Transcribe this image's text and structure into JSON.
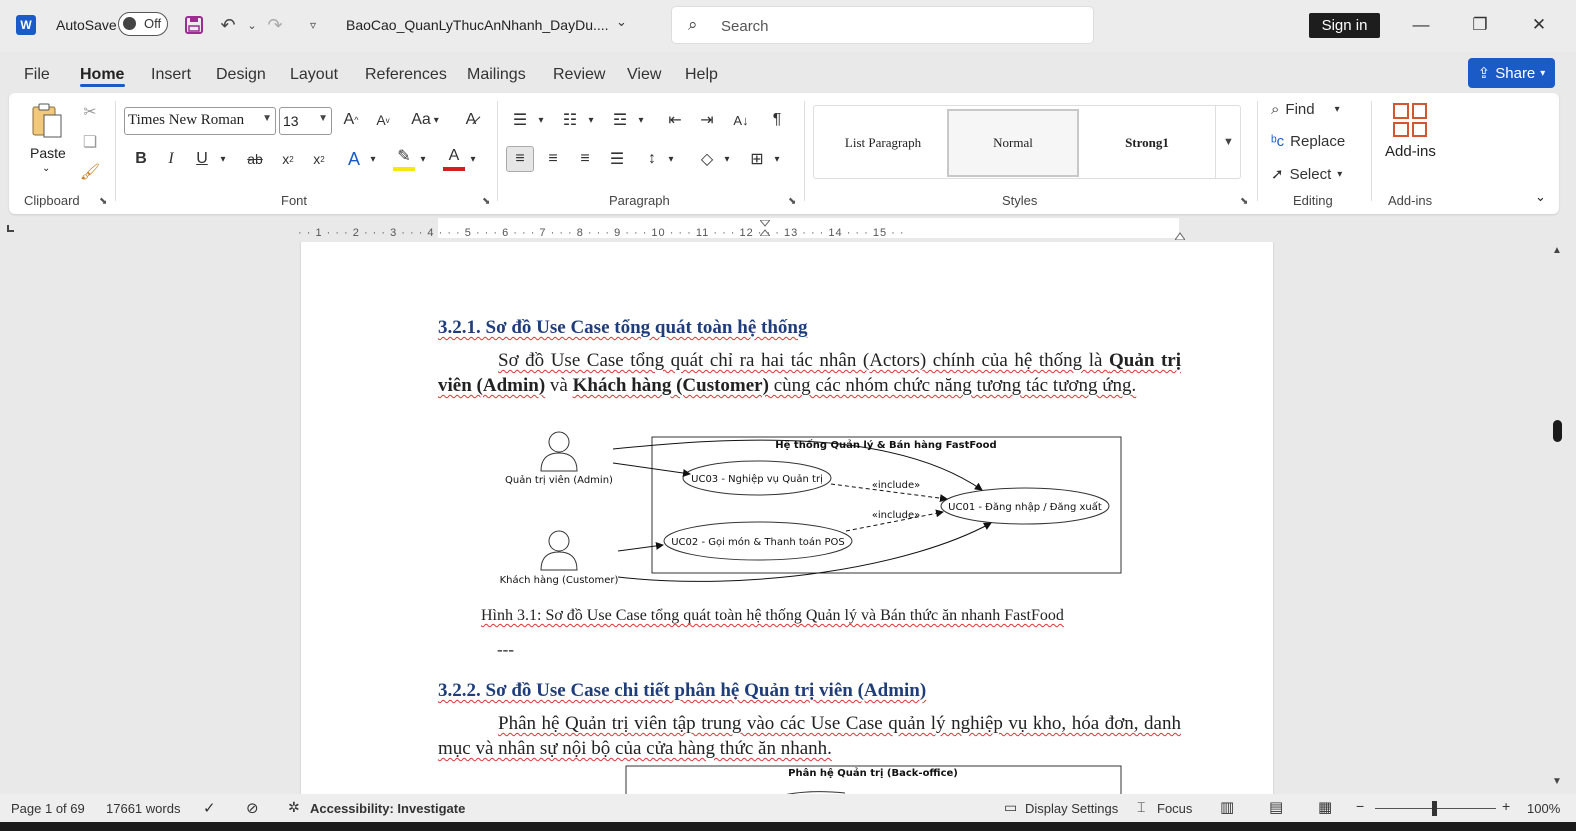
{
  "titlebar": {
    "app_icon": "W",
    "autosave_label": "AutoSave",
    "autosave_state": "Off",
    "doc_title": "BaoCao_QuanLyThucAnNhanh_DayDu....",
    "search_placeholder": "Search",
    "sign_in": "Sign in"
  },
  "tabs": [
    "File",
    "Home",
    "Insert",
    "Design",
    "Layout",
    "References",
    "Mailings",
    "Review",
    "View",
    "Help"
  ],
  "share_label": "Share",
  "ribbon": {
    "clipboard": {
      "paste": "Paste",
      "label": "Clipboard"
    },
    "font": {
      "name": "Times New Roman",
      "size": "13",
      "label": "Font",
      "case_btn": "Aa"
    },
    "paragraph": {
      "label": "Paragraph"
    },
    "styles": {
      "items": [
        "List Paragraph",
        "Normal",
        "Strong1"
      ],
      "label": "Styles"
    },
    "editing": {
      "find": "Find",
      "replace": "Replace",
      "select": "Select",
      "label": "Editing"
    },
    "addins": {
      "button": "Add-ins",
      "label": "Add-ins"
    }
  },
  "ruler_text": "· · 1 · · · 2 · · · 3 · · · 4 · · · 5 · · · 6 · · · 7 · · · 8 · · · 9 · · · 10 · · · 11 · · · 12 · · · 13 · · · 14 · · · 15 · ·",
  "document": {
    "heading1": "3.2.1. Sơ đồ Use Case tổng quát toàn hệ thống",
    "para1": {
      "a": "Sơ đồ Use Case tổng quát chỉ ra hai tác nhân (Actors) chính của hệ thống là ",
      "b": "Quản trị viên (Admin)",
      "c": " và ",
      "d": "Khách hàng (Customer)",
      "e": " cùng các nhóm chức năng tương tác tương ứng."
    },
    "diagram1": {
      "system_title": "Hệ thống Quản lý & Bán hàng FastFood",
      "actor_admin": "Quản trị viên (Admin)",
      "actor_customer": "Khách hàng (Customer)",
      "uc03": "UC03 - Nghiệp vụ Quản trị",
      "uc01": "UC01 - Đăng nhập / Đăng xuất",
      "uc02": "UC02 - Gọi món & Thanh toán POS",
      "include1": "«include»",
      "include2": "«include»"
    },
    "caption1": "Hình 3.1: Sơ đồ Use Case tổng quát toàn hệ thống Quản lý và Bán thức ăn nhanh FastFood",
    "separator": "---",
    "heading2": "3.2.2. Sơ đồ Use Case chi tiết phân hệ Quản trị viên (Admin)",
    "para2": "Phân hệ Quản trị viên tập trung vào các Use Case quản lý nghiệp vụ kho, hóa đơn, danh mục và nhân sự nội bộ của cửa hàng thức ăn nhanh.",
    "diagram2_title": "Phân hệ Quản trị (Back-office)"
  },
  "status": {
    "page": "Page 1 of 69",
    "words": "17661 words",
    "accessibility": "Accessibility: Investigate",
    "display_settings": "Display Settings",
    "focus": "Focus",
    "zoom": "100%"
  }
}
